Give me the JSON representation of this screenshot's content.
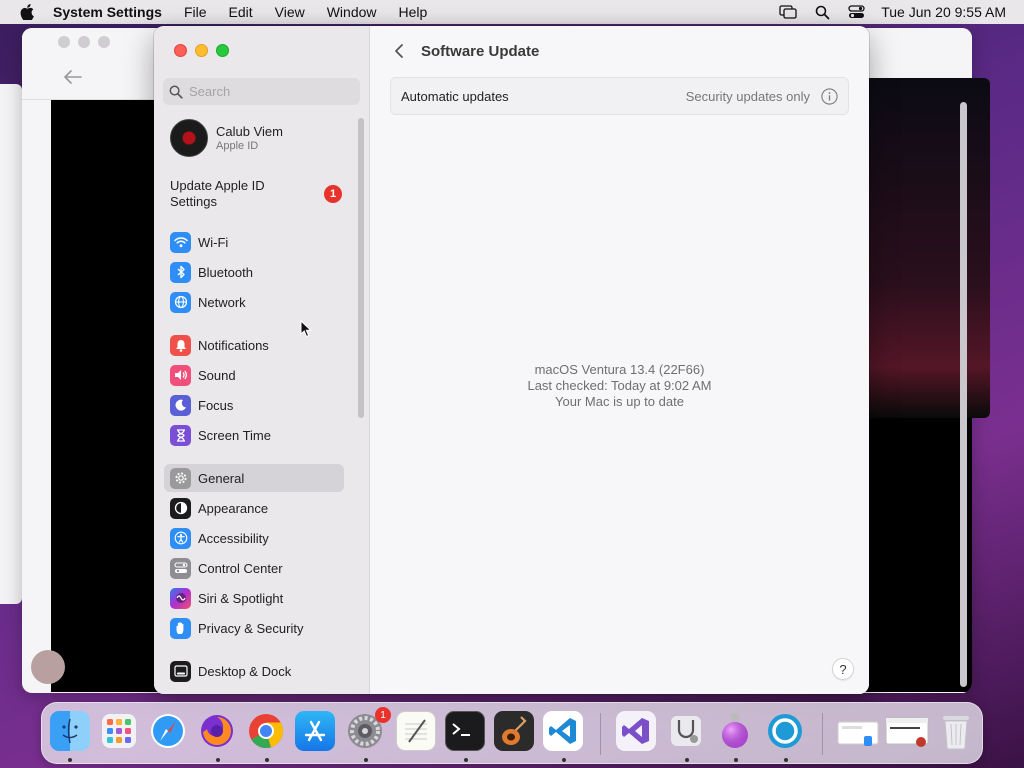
{
  "menubar": {
    "app_name": "System Settings",
    "menus": [
      "File",
      "Edit",
      "View",
      "Window",
      "Help"
    ],
    "clock": "Tue Jun 20  9:55 AM"
  },
  "window": {
    "search": {
      "placeholder": "Search",
      "value": ""
    },
    "account": {
      "name": "Calub Viem",
      "subtitle": "Apple ID"
    },
    "update_apple_id": {
      "label": "Update Apple ID Settings",
      "badge": "1"
    },
    "sidebar_items": [
      {
        "label": "Wi-Fi",
        "icon": "wifi-icon",
        "color": "#2f8ef5",
        "selected": false
      },
      {
        "label": "Bluetooth",
        "icon": "bluetooth-icon",
        "color": "#2f8ef5",
        "selected": false
      },
      {
        "label": "Network",
        "icon": "globe-icon",
        "color": "#2f8ef5",
        "selected": false
      },
      {
        "label": "Notifications",
        "icon": "bell-icon",
        "color": "#f0504a",
        "selected": false
      },
      {
        "label": "Sound",
        "icon": "speaker-icon",
        "color": "#ef4f7a",
        "selected": false
      },
      {
        "label": "Focus",
        "icon": "moon-icon",
        "color": "#5b5fd6",
        "selected": false
      },
      {
        "label": "Screen Time",
        "icon": "hourglass-icon",
        "color": "#7a4fd6",
        "selected": false
      },
      {
        "label": "General",
        "icon": "gear-icon",
        "color": "#9a999c",
        "selected": true
      },
      {
        "label": "Appearance",
        "icon": "appearance-icon",
        "color": "#1c1c1e",
        "selected": false
      },
      {
        "label": "Accessibility",
        "icon": "accessibility-icon",
        "color": "#2f8ef5",
        "selected": false
      },
      {
        "label": "Control Center",
        "icon": "control-center-icon",
        "color": "#8e8d91",
        "selected": false
      },
      {
        "label": "Siri & Spotlight",
        "icon": "siri-icon",
        "color": "#b02fd0",
        "selected": false
      },
      {
        "label": "Privacy & Security",
        "icon": "hand-icon",
        "color": "#2f8ef5",
        "selected": false
      },
      {
        "label": "Desktop & Dock",
        "icon": "dock-icon",
        "color": "#1c1c1e",
        "selected": false
      }
    ],
    "content": {
      "title": "Software Update",
      "automatic_updates": {
        "label": "Automatic updates",
        "value": "Security updates only"
      },
      "status": {
        "version": "macOS Ventura 13.4 (22F66)",
        "last_checked": "Last checked: Today at 9:02 AM",
        "message": "Your Mac is up to date"
      },
      "help_label": "?"
    }
  },
  "dock": {
    "apps": [
      {
        "name": "Finder",
        "icon": "finder-icon",
        "running": true
      },
      {
        "name": "Launchpad",
        "icon": "launchpad-icon",
        "running": false
      },
      {
        "name": "Safari",
        "icon": "safari-icon",
        "running": false
      },
      {
        "name": "Firefox",
        "icon": "firefox-icon",
        "running": true
      },
      {
        "name": "Chrome",
        "icon": "chrome-icon",
        "running": true
      },
      {
        "name": "App Store",
        "icon": "app-store-icon",
        "running": false
      },
      {
        "name": "System Settings",
        "icon": "system-settings-icon",
        "running": true,
        "badge": "1"
      },
      {
        "name": "TextEdit",
        "icon": "textedit-icon",
        "running": false
      },
      {
        "name": "Terminal",
        "icon": "terminal-icon",
        "running": true
      },
      {
        "name": "GarageBand",
        "icon": "garageband-icon",
        "running": false
      },
      {
        "name": "Visual Studio Code",
        "icon": "vscode-icon",
        "running": true
      },
      {
        "name": "Visual Studio",
        "icon": "visual-studio-icon",
        "running": false
      },
      {
        "name": "Disk Utility",
        "icon": "disk-utility-icon",
        "running": true
      },
      {
        "name": "Installer",
        "icon": "installer-icon",
        "running": true
      },
      {
        "name": "Setup Assistant",
        "icon": "setup-icon",
        "running": true
      },
      {
        "name": "Downloads",
        "icon": "downloads-stack-icon",
        "running": false
      },
      {
        "name": "Recent Windows",
        "icon": "window-stack-icon",
        "running": false
      },
      {
        "name": "Trash",
        "icon": "trash-icon",
        "running": false
      }
    ]
  }
}
